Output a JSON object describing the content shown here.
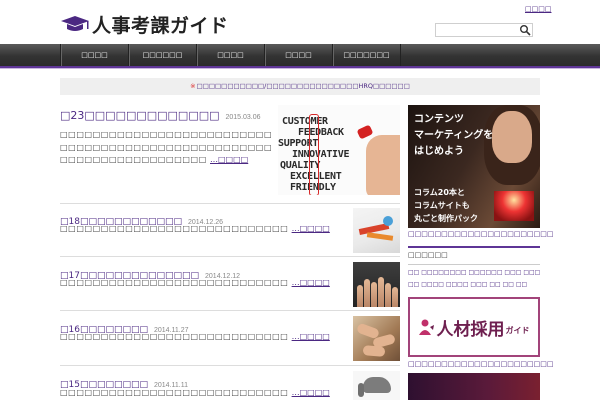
{
  "header": {
    "logo_text": "人事考課ガイド",
    "top_link": "□□□□"
  },
  "nav": [
    "□□□□",
    "□□□□□□",
    "□□□□",
    "□□□□",
    "□□□□□□□"
  ],
  "notice": {
    "mark": "※",
    "text": "□□□□□□□□□□□/□□□□□□□□□□□□□□□HRQ□□□□□□"
  },
  "featured": {
    "title": "□23□□□□□□□□□□□□□",
    "date": "2015.03.06",
    "excerpt": "□□□□□□□□□□□□□□□□□□□□□□□□□□□□□□□□□□□□□□□□□□□□□□□□□□□□□□□□□□□□□□□□□□□□□□ ",
    "more": "…□□□□",
    "image_words": [
      "CUSTOMER",
      "FEEDBACK",
      "SUPPORT",
      "INNOVATIVE",
      "QUALITY",
      "EXCELLENT",
      "FRIENDLY"
    ]
  },
  "posts": [
    {
      "title": "□18□□□□□□□□□□□□",
      "date": "2014.12.26",
      "excerpt": "□□□□□□□□□□□□□□□□□□□□□□□□□□□□ ",
      "more": "…□□□□"
    },
    {
      "title": "□17□□□□□□□□□□□□□□",
      "date": "2014.12.12",
      "excerpt": "□□□□□□□□□□□□□□□□□□□□□□□□□□□□ ",
      "more": "…□□□□"
    },
    {
      "title": "□16□□□□□□□□",
      "date": "2014.11.27",
      "excerpt": "□□□□□□□□□□□□□□□□□□□□□□□□□□□□ ",
      "more": "…□□□□"
    },
    {
      "title": "□15□□□□□□□□",
      "date": "2014.11.11",
      "excerpt": "□□□□□□□□□□□□□□□□□□□□□□□□□□□□ ",
      "more": "…□□□□"
    }
  ],
  "sidebar": {
    "ad": {
      "headline": [
        "コンテンツ",
        "マーケティングを",
        "はじめよう"
      ],
      "sub": [
        "コラム20本と",
        "コラムサイトも",
        "丸ごと制作パック"
      ],
      "caption": "□□□□□□□□□□□□□□□□□□□□□□"
    },
    "section_title": "□□□□□□",
    "links": [
      "□□ □□□□□□□□ □□□□□□ □□□ □□□□ □□□□□□□□ □□",
      "□□ □□□□ □□□□ □□□ □□ □□ □□"
    ],
    "recruit_banner": {
      "main": "人材採用",
      "sub": "ガイド",
      "caption": "□□□□□□□□□□□□□□□□□□□□□□"
    }
  },
  "colors": {
    "accent": "#4b2882",
    "nav_bg": "#333333",
    "nav_border": "#5e3596",
    "banner_border": "#a2447a"
  }
}
